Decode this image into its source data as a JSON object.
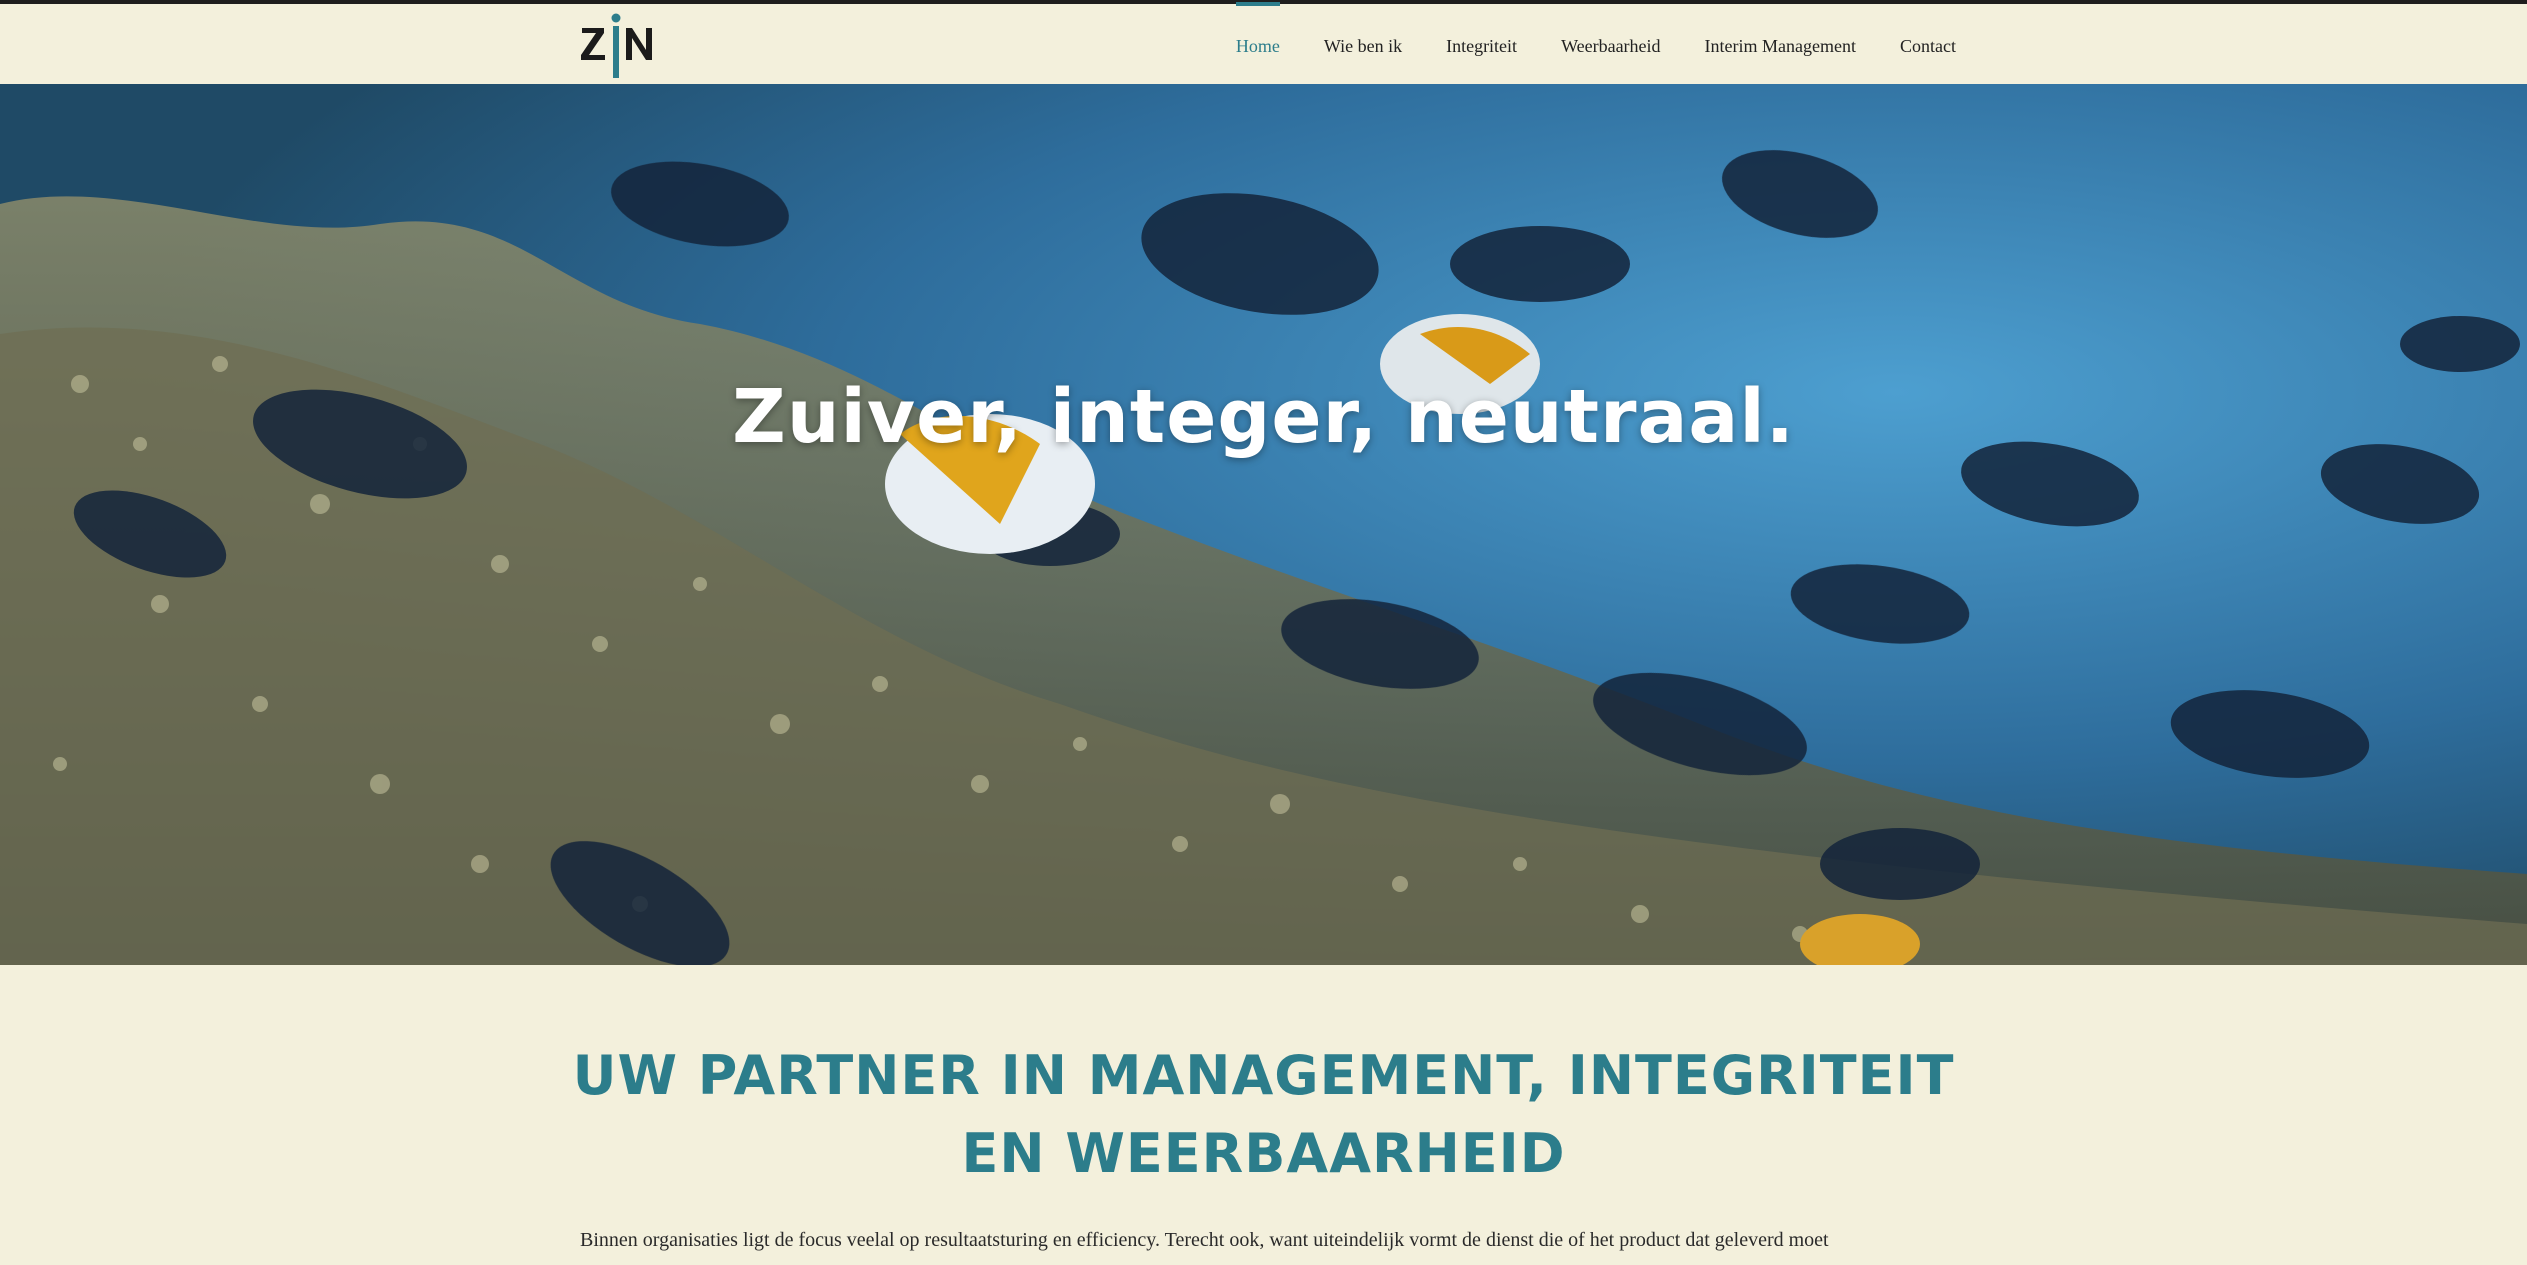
{
  "site": {
    "logo_text": "ZiN",
    "accent_color": "#2c7d8b",
    "background_color": "#f3f0dc"
  },
  "nav": {
    "items": [
      {
        "label": "Home",
        "active": true
      },
      {
        "label": "Wie ben ik",
        "active": false
      },
      {
        "label": "Integriteit",
        "active": false
      },
      {
        "label": "Weerbaarheid",
        "active": false
      },
      {
        "label": "Interim Management",
        "active": false
      },
      {
        "label": "Contact",
        "active": false
      }
    ]
  },
  "hero": {
    "title": "Zuiver, integer, neutraal."
  },
  "main": {
    "heading": "UW PARTNER IN MANAGEMENT, INTEGRITEIT EN WEERBAARHEID",
    "intro": "Binnen organisaties ligt de focus veelal op resultaatsturing en efficiency. Terecht ook, want uiteindelijk vormt de dienst die of het product dat geleverd moet"
  }
}
